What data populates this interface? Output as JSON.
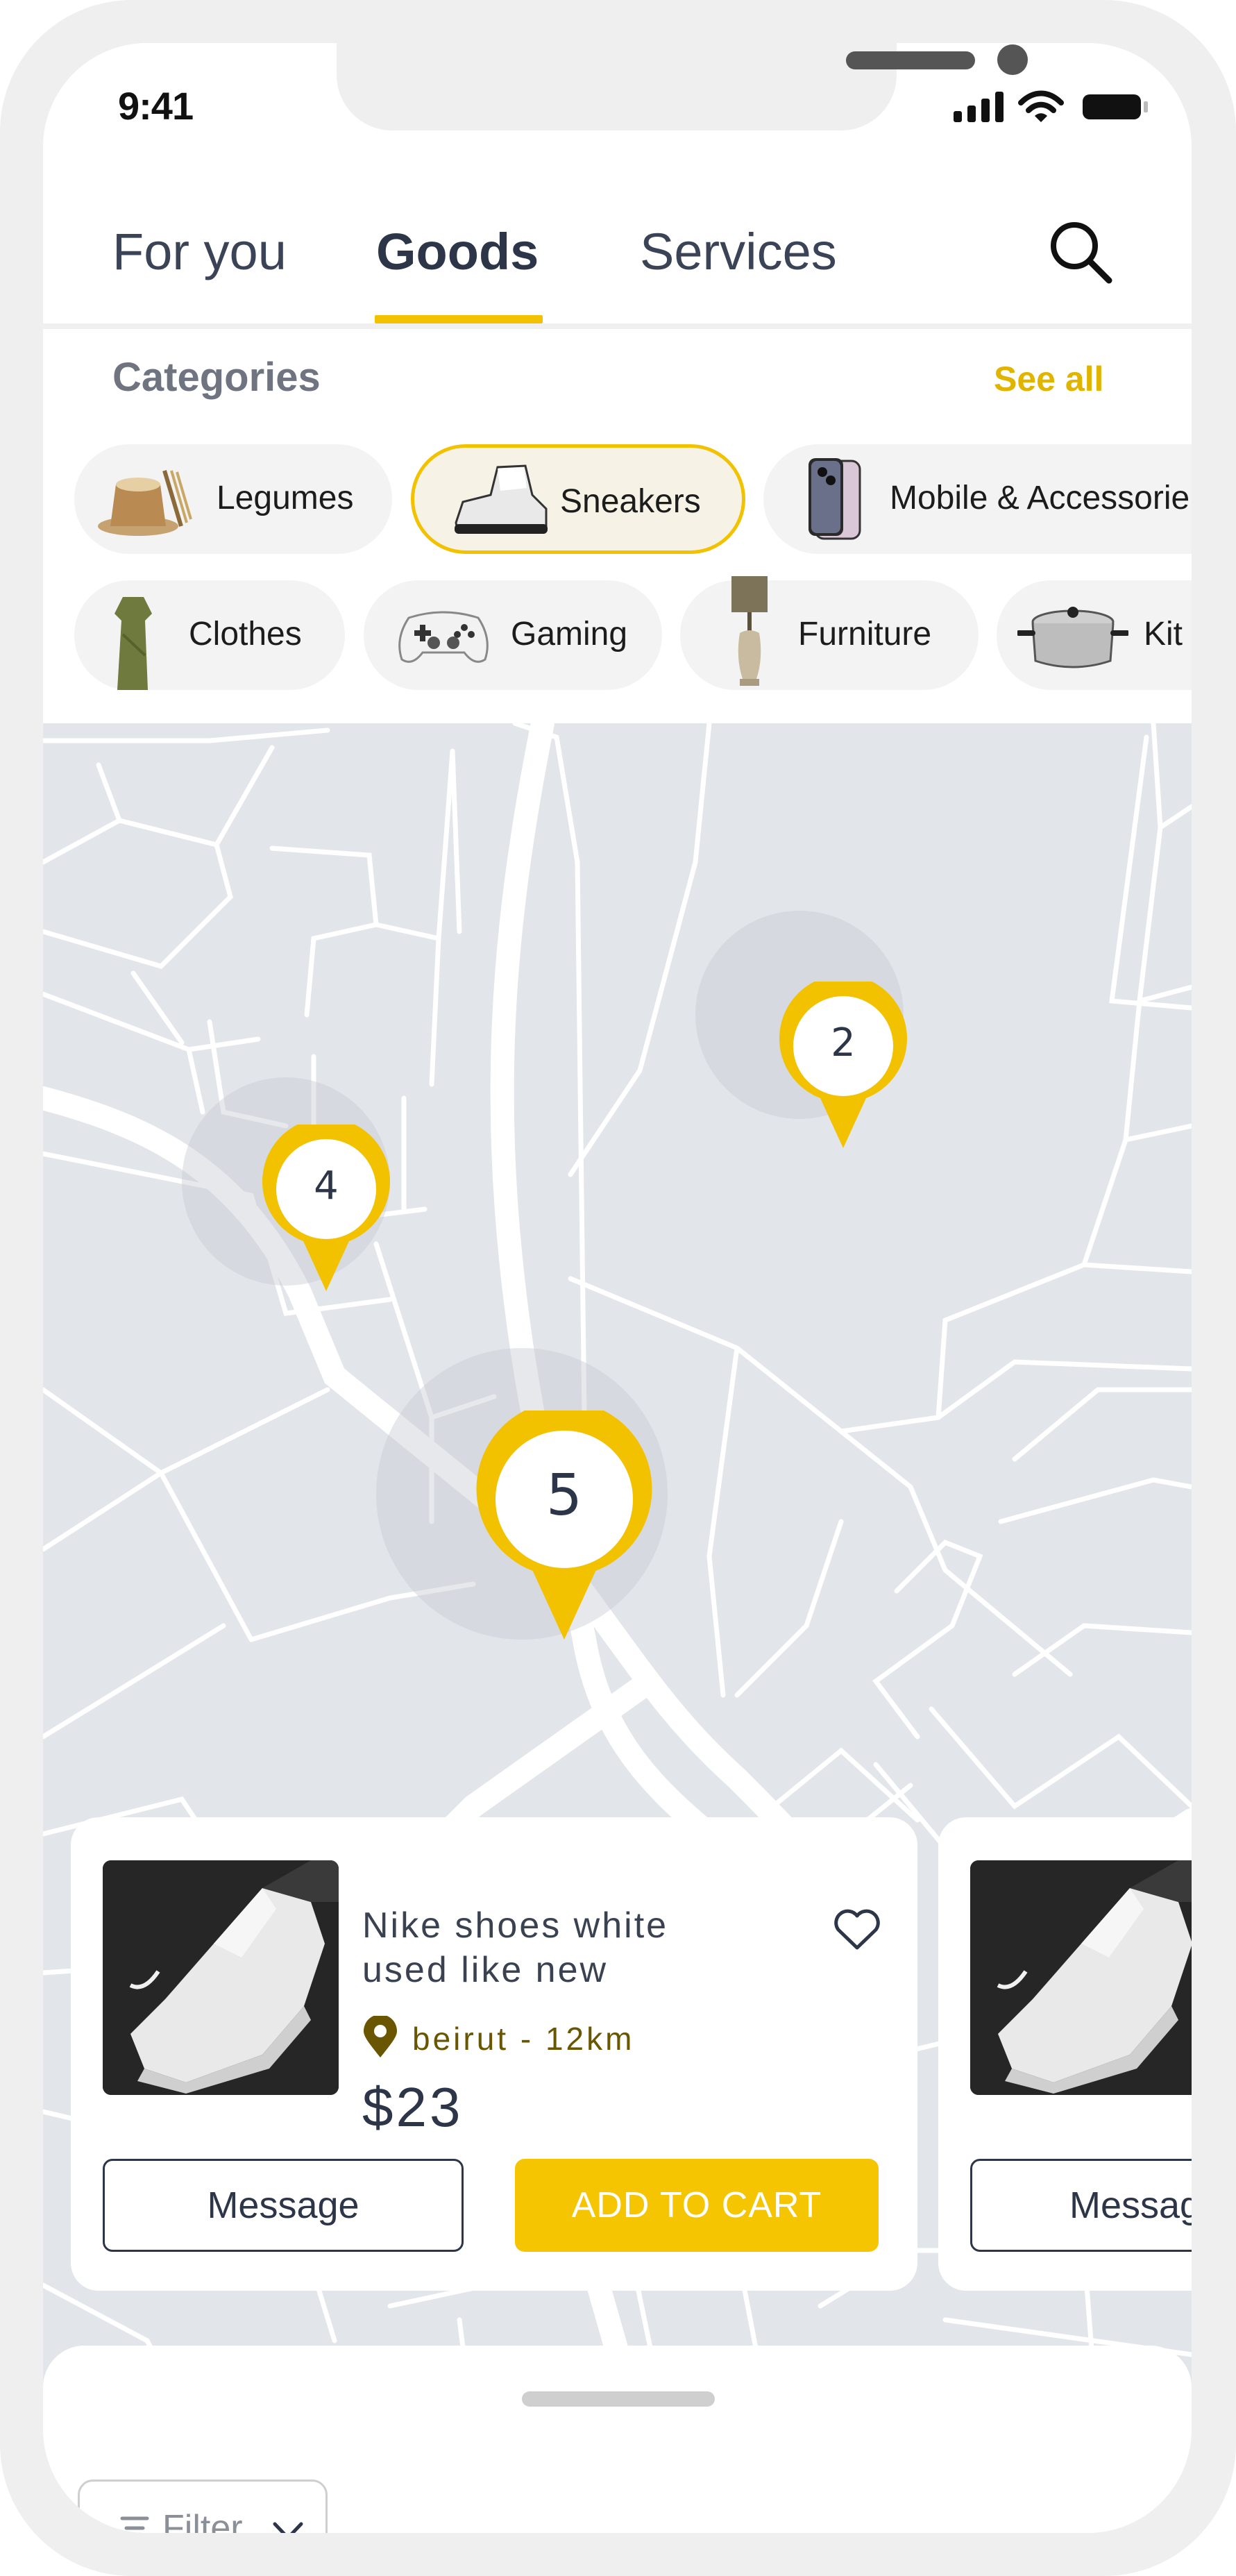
{
  "status_bar": {
    "time": "9:41"
  },
  "tabs": [
    {
      "label": "For you",
      "active": false
    },
    {
      "label": "Goods",
      "active": true
    },
    {
      "label": "Services",
      "active": false
    }
  ],
  "search": {
    "icon": "search-icon"
  },
  "categories": {
    "title": "Categories",
    "see_all": "See all",
    "row1": [
      {
        "label": "Legumes",
        "selected": false
      },
      {
        "label": "Sneakers",
        "selected": true
      },
      {
        "label": "Mobile & Accessorie",
        "selected": false
      }
    ],
    "row2": [
      {
        "label": "Clothes",
        "selected": false
      },
      {
        "label": "Gaming",
        "selected": false
      },
      {
        "label": "Furniture",
        "selected": false
      },
      {
        "label": "Kit",
        "selected": false
      }
    ]
  },
  "map": {
    "clusters": [
      {
        "count": "2"
      },
      {
        "count": "4"
      },
      {
        "count": "5"
      }
    ]
  },
  "product_card": {
    "title": "Nike shoes white used like new",
    "location": "beirut - 12km",
    "price": "$23",
    "message_label": "Message",
    "add_to_cart_label": "ADD TO CART"
  },
  "product_card_next": {
    "message_label": "Messag"
  },
  "bottom_sheet": {
    "filter_label": "Filter"
  },
  "colors": {
    "accent": "#f2c200",
    "text_dark": "#2d3648",
    "map_bg": "#e2e5ea"
  }
}
